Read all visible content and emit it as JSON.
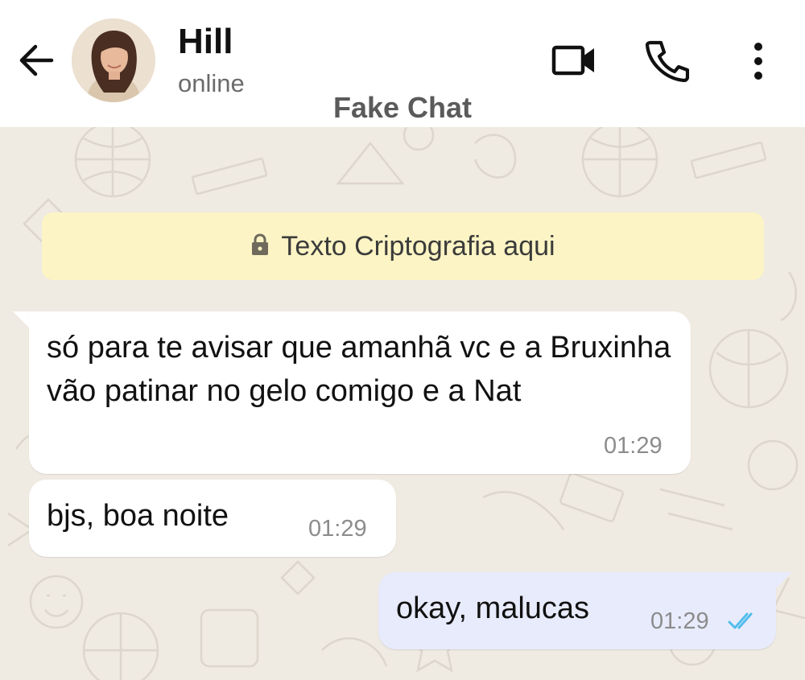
{
  "header": {
    "contact_name": "Hill",
    "status": "online",
    "icons": [
      "back-arrow-icon",
      "video-call-icon",
      "phone-icon",
      "more-vert-icon"
    ]
  },
  "watermark": "Fake Chat",
  "encryption_banner": {
    "text": "Texto Criptografia aqui",
    "icon": "lock-icon"
  },
  "messages": [
    {
      "direction": "incoming",
      "text": "só para te avisar que amanhã vc e a Bruxinha vão patinar no gelo comigo e a Nat",
      "time": "01:29"
    },
    {
      "direction": "incoming",
      "text": "bjs, boa noite",
      "time": "01:29"
    },
    {
      "direction": "outgoing",
      "text": "okay, malucas",
      "time": "01:29",
      "read_status": "read"
    }
  ],
  "colors": {
    "chat_background": "#efeae2",
    "banner_background": "#fcf4c4",
    "incoming_bubble": "#ffffff",
    "outgoing_bubble": "#e8ebfc",
    "read_ticks": "#53bdeb"
  }
}
